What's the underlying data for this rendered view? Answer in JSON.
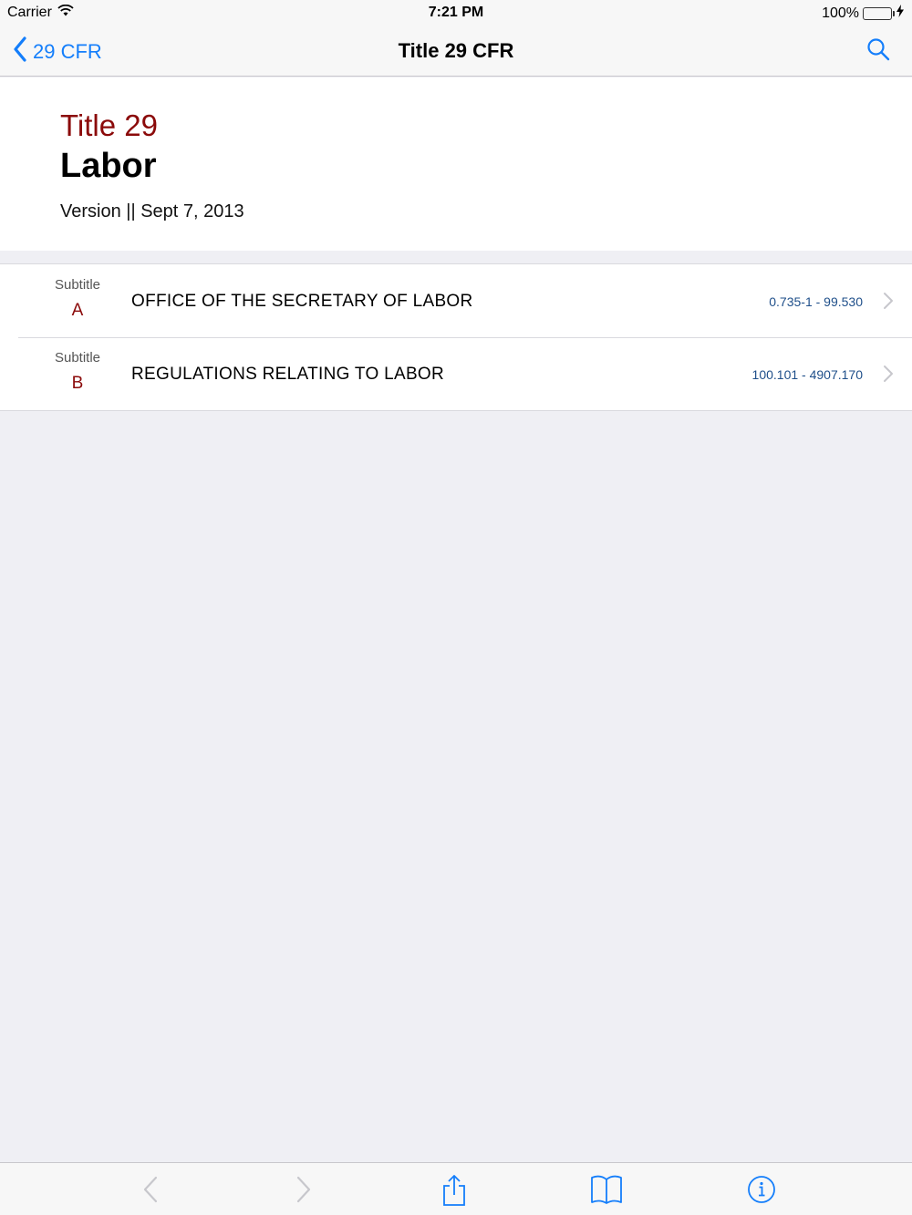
{
  "status_bar": {
    "carrier": "Carrier",
    "time": "7:21 PM",
    "battery_percent": "100%",
    "battery_level": 1.0,
    "battery_color": "#4cd964"
  },
  "nav": {
    "back_label": "29 CFR",
    "title": "Title 29 CFR",
    "accent_color": "#147efb"
  },
  "header": {
    "title_number": "Title 29",
    "title_name": "Labor",
    "version": "Version || Sept 7, 2013"
  },
  "subtitles": [
    {
      "label": "Subtitle",
      "letter": "A",
      "title": "OFFICE OF THE SECRETARY OF LABOR",
      "range": "0.735-1 - 99.530"
    },
    {
      "label": "Subtitle",
      "letter": "B",
      "title": "REGULATIONS RELATING TO LABOR",
      "range": "100.101 - 4907.170"
    }
  ],
  "toolbar": {
    "icons": [
      "back-arrow-icon",
      "forward-arrow-icon",
      "share-icon",
      "bookmarks-book-icon",
      "info-icon"
    ]
  }
}
